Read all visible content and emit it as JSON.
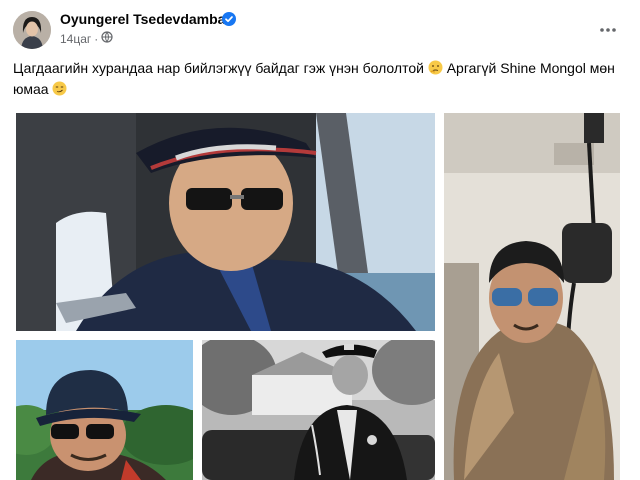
{
  "post": {
    "author": "Oyungerel Tsedevdamba",
    "time": "14цаг",
    "separator": "·",
    "text_line1": "Цагдаагийн хурандаа нар бийлэгжүү байдаг гэж үнэн бололтой",
    "text_line1b": "Аргагүй Shine Mongol мөн",
    "text_line2": "юмаа"
  },
  "icons": {
    "verified": "verified-badge-icon",
    "privacy": "globe-icon",
    "more": "more-options-icon",
    "emoji1": "thinking-face-emoji",
    "emoji2": "smirking-face-emoji"
  },
  "colors": {
    "verified": "#1877f2",
    "meta": "#65676b",
    "text": "#050505"
  }
}
